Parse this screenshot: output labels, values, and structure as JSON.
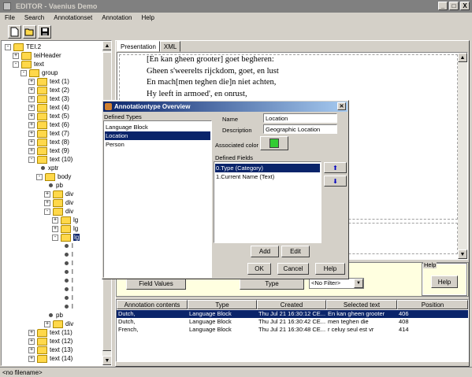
{
  "window": {
    "title": "EDITOR - Vaenius Demo",
    "buttons": [
      "_",
      "□",
      "X"
    ]
  },
  "menu": [
    "File",
    "Search",
    "Annotationset",
    "Annotation",
    "Help"
  ],
  "toolbar": {
    "items": [
      "new-document-icon",
      "open-folder-icon",
      "save-icon"
    ]
  },
  "tree": {
    "items": [
      {
        "label": "TEI.2",
        "level": 0,
        "icon": "folder",
        "expander": "-"
      },
      {
        "label": "teiHeader",
        "level": 1,
        "icon": "folder",
        "expander": "+"
      },
      {
        "label": "text",
        "level": 1,
        "icon": "folder",
        "expander": "-"
      },
      {
        "label": "group",
        "level": 2,
        "icon": "folder",
        "expander": "-"
      },
      {
        "label": "text (1)",
        "level": 3,
        "icon": "folder",
        "expander": "+"
      },
      {
        "label": "text (2)",
        "level": 3,
        "icon": "folder",
        "expander": "+"
      },
      {
        "label": "text (3)",
        "level": 3,
        "icon": "folder",
        "expander": "+"
      },
      {
        "label": "text (4)",
        "level": 3,
        "icon": "folder",
        "expander": "+"
      },
      {
        "label": "text (5)",
        "level": 3,
        "icon": "folder",
        "expander": "+"
      },
      {
        "label": "text (6)",
        "level": 3,
        "icon": "folder",
        "expander": "+"
      },
      {
        "label": "text (7)",
        "level": 3,
        "icon": "folder",
        "expander": "+"
      },
      {
        "label": "text (8)",
        "level": 3,
        "icon": "folder",
        "expander": "+"
      },
      {
        "label": "text (9)",
        "level": 3,
        "icon": "folder",
        "expander": "+"
      },
      {
        "label": "text (10)",
        "level": 3,
        "icon": "folder",
        "expander": "-"
      },
      {
        "label": "xptr",
        "level": 4,
        "icon": "dot",
        "expander": ""
      },
      {
        "label": "body",
        "level": 4,
        "icon": "folder",
        "expander": "-"
      },
      {
        "label": "pb",
        "level": 5,
        "icon": "dot",
        "expander": ""
      },
      {
        "label": "div",
        "level": 5,
        "icon": "folder",
        "expander": "+"
      },
      {
        "label": "div",
        "level": 5,
        "icon": "folder",
        "expander": "+"
      },
      {
        "label": "div",
        "level": 5,
        "icon": "folder",
        "expander": "-"
      },
      {
        "label": "lg",
        "level": 6,
        "icon": "folder",
        "expander": "+"
      },
      {
        "label": "lg",
        "level": 6,
        "icon": "folder",
        "expander": "+"
      },
      {
        "label": "lg",
        "level": 6,
        "icon": "folder",
        "expander": "-",
        "selected": true
      },
      {
        "label": "l",
        "level": 7,
        "icon": "dot",
        "expander": ""
      },
      {
        "label": "l",
        "level": 7,
        "icon": "dot",
        "expander": ""
      },
      {
        "label": "l",
        "level": 7,
        "icon": "dot",
        "expander": ""
      },
      {
        "label": "l",
        "level": 7,
        "icon": "dot",
        "expander": ""
      },
      {
        "label": "l",
        "level": 7,
        "icon": "dot",
        "expander": ""
      },
      {
        "label": "l",
        "level": 7,
        "icon": "dot",
        "expander": ""
      },
      {
        "label": "l",
        "level": 7,
        "icon": "dot",
        "expander": ""
      },
      {
        "label": "l",
        "level": 7,
        "icon": "dot",
        "expander": ""
      },
      {
        "label": "pb",
        "level": 5,
        "icon": "dot",
        "expander": ""
      },
      {
        "label": "div",
        "level": 5,
        "icon": "folder",
        "expander": "+"
      },
      {
        "label": "text (11)",
        "level": 3,
        "icon": "folder",
        "expander": "+"
      },
      {
        "label": "text (12)",
        "level": 3,
        "icon": "folder",
        "expander": "+"
      },
      {
        "label": "text (13)",
        "level": 3,
        "icon": "folder",
        "expander": "+"
      },
      {
        "label": "text (14)",
        "level": 3,
        "icon": "folder",
        "expander": "+"
      }
    ]
  },
  "tabs": [
    {
      "label": "Presentation",
      "active": true
    },
    {
      "label": "XML",
      "active": false
    }
  ],
  "presentation": {
    "lines": [
      "[En kan gheen grooter] goet begheren:",
      "Gheen s'weerelts rijckdom, goet, en lust",
      "En mach[men teghen die]n niet achten,",
      "Hy leeft in armoed', en onrust,"
    ]
  },
  "bottom": {
    "field_values_label": "Field Values",
    "type_label": "Type",
    "filter_value": "<No Filter>",
    "help_group_label": "Help",
    "help_label": "Help"
  },
  "table": {
    "columns": [
      "Annotation contents",
      "Type",
      "Created",
      "Selected text",
      "Position"
    ],
    "rows": [
      {
        "cells": [
          "Dutch,",
          "Language Block",
          "Thu Jul 21 16:30:12 CE...",
          "En kan gheen grooter",
          "406"
        ],
        "selected": true
      },
      {
        "cells": [
          "Dutch,",
          "Language Block",
          "Thu Jul 21 16:30:42 CE...",
          "men teghen die",
          "408"
        ],
        "selected": false
      },
      {
        "cells": [
          "French,",
          "Language Block",
          "Thu Jul 21 16:30:48 CE...",
          "r celuy seul est vr",
          "414"
        ],
        "selected": false
      }
    ]
  },
  "status": "<no filename>",
  "dialog": {
    "title": "Annotationtype Overview",
    "defined_types_label": "Defined Types",
    "types": [
      {
        "label": "Language Block",
        "selected": false
      },
      {
        "label": "Location",
        "selected": true
      },
      {
        "label": "Person",
        "selected": false
      }
    ],
    "name_label": "Name",
    "name_value": "Location",
    "description_label": "Description",
    "description_value": "Geographic Location",
    "color_label": "Associated color",
    "color": "#33cc33",
    "fields_label": "Defined Fields",
    "fields": [
      {
        "label": "0.Type (Category)",
        "selected": true
      },
      {
        "label": "1.Current Name (Text)",
        "selected": false
      }
    ],
    "add_label": "Add",
    "edit_label": "Edit",
    "ok_label": "OK",
    "cancel_label": "Cancel",
    "help_label": "Help"
  }
}
